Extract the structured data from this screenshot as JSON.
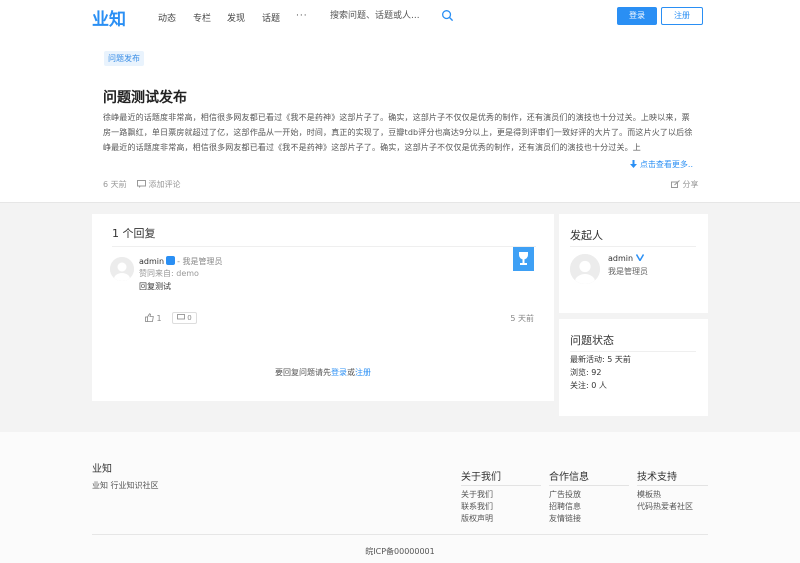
{
  "header": {
    "logo": "业知",
    "nav": [
      "动态",
      "专栏",
      "发现",
      "话题",
      "···"
    ],
    "search_placeholder": "搜索问题、话题或人...",
    "login_label": "登录",
    "register_label": "注册"
  },
  "question": {
    "tag": "问题发布",
    "title": "问题测试发布",
    "body": "徐峥最近的话题度非常高，相信很多网友都已看过《我不是药神》这部片子了。确实，这部片子不仅仅是优秀的制作，还有演员们的演技也十分过关。上映以来，票房一路飘红，单日票房就超过了亿，这部作品从一开始，时间，真正的实现了，豆瓣tdb评分也高达9分以上，更是得到评审们一致好评的大片了。而这片火了以后徐峥最近的话题度非常高，相信很多网友都已看过《我不是药神》这部片子了。确实，这部片子不仅仅是优秀的制作，还有演员们的演技也十分过关。上",
    "view_more": "点击查看更多",
    "time": "6 天前",
    "add_comment": "添加评论",
    "share": "分享"
  },
  "answers": {
    "title": "1 个回复",
    "items": [
      {
        "name": "admin",
        "role": "- 我是管理员",
        "agree": "赞同来自: demo",
        "content": "回复测试",
        "likes": "1",
        "comments": "0",
        "time": "5 天前"
      }
    ],
    "login_hint_prefix": "要回复问题请先",
    "login_link": "登录",
    "or_text": "或",
    "register_link": "注册"
  },
  "asker": {
    "title": "发起人",
    "name": "admin",
    "role": "我是管理员"
  },
  "status": {
    "title": "问题状态",
    "last_active": "最新活动: 5 天前",
    "views": "浏览: 92",
    "follows": "关注: 0 人"
  },
  "footer": {
    "logo": "业知",
    "desc": "业知 行业知识社区",
    "columns": [
      {
        "title": "关于我们",
        "links": [
          "关于我们",
          "联系我们",
          "版权声明"
        ]
      },
      {
        "title": "合作信息",
        "links": [
          "广告投放",
          "招聘信息",
          "友情链接"
        ]
      },
      {
        "title": "技术支持",
        "links": [
          "模板热",
          "代码热爱者社区"
        ]
      }
    ],
    "icp": "皖ICP备00000001"
  },
  "colors": {
    "accent": "#2a8ff4",
    "page_bg": "#f3f3f3"
  }
}
